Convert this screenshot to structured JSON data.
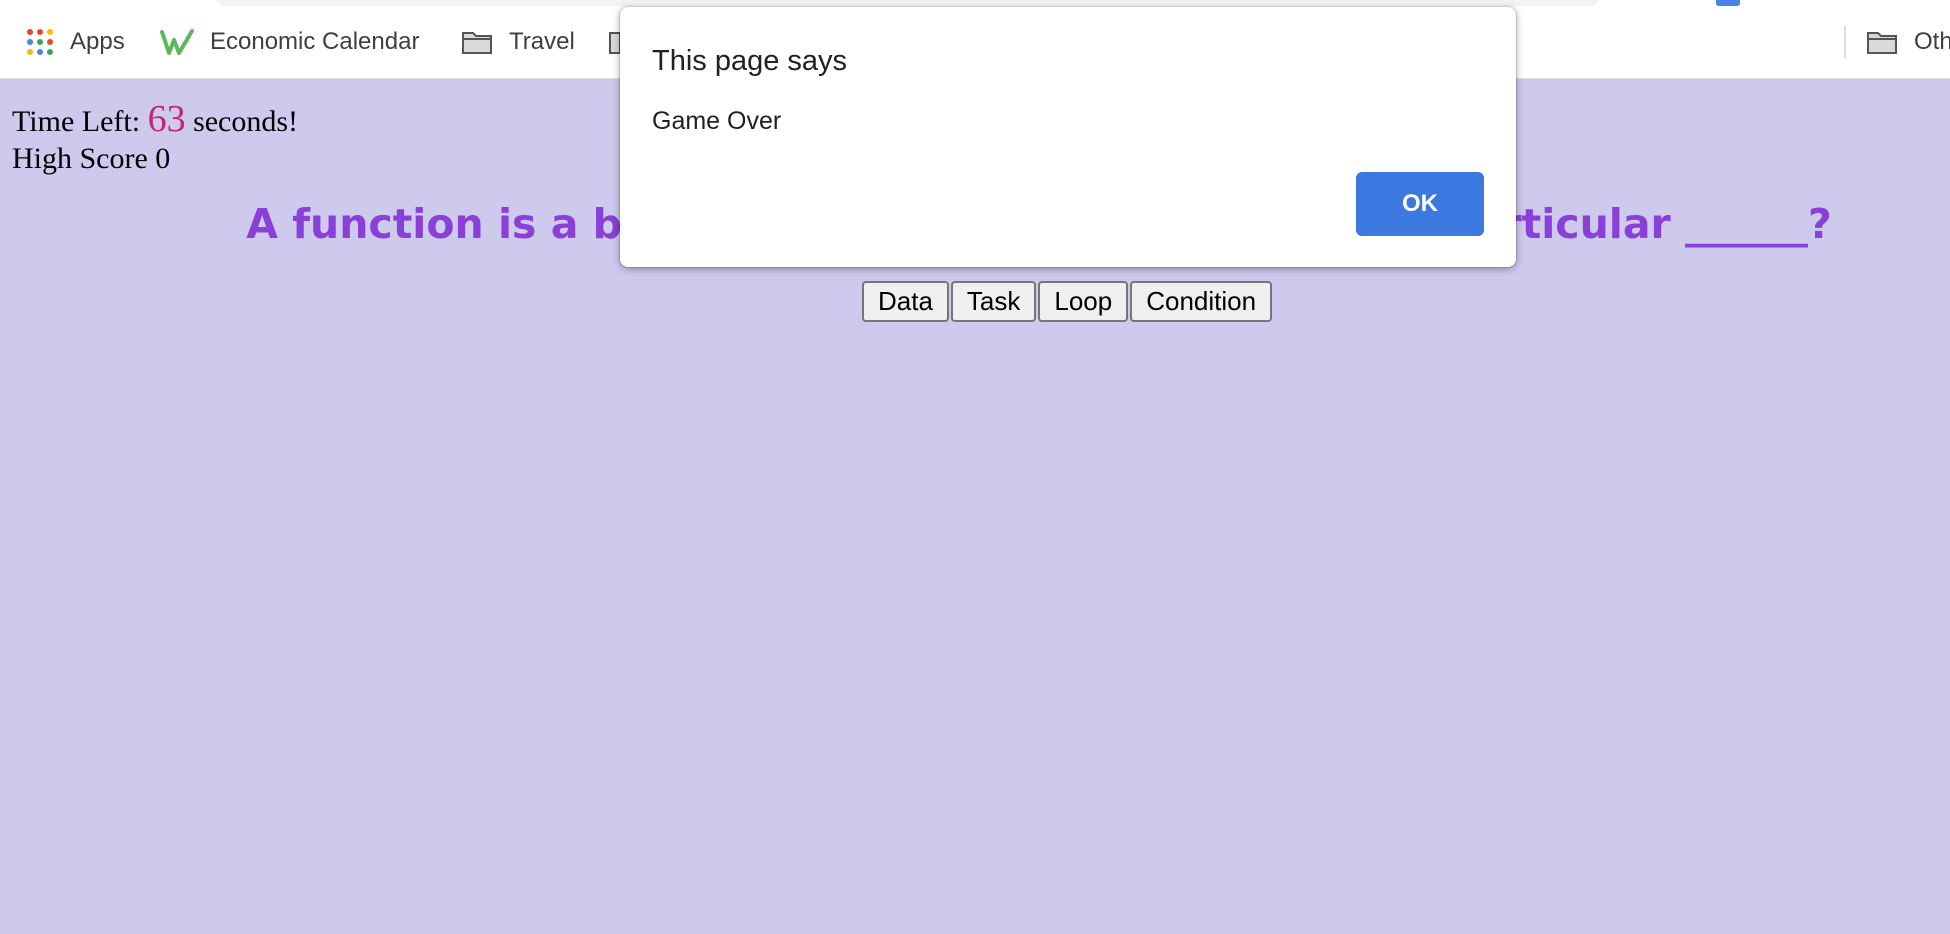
{
  "bookmarks": {
    "apps_label": "Apps",
    "economic_calendar_label": "Economic Calendar",
    "travel_label": "Travel",
    "other_label_partial": "Oth"
  },
  "game": {
    "time_left_prefix": "Time Left:",
    "time_left_value": "63",
    "time_left_suffix": "seconds!",
    "high_score_text": "High Score 0",
    "question": "A function is a block of code designed to perform a particular ______?",
    "answers": [
      "Data",
      "Task",
      "Loop",
      "Condition"
    ]
  },
  "dialog": {
    "title": "This page says",
    "message": "Game Over",
    "ok_label": "OK"
  },
  "colors": {
    "page_background": "#cdcaee",
    "question_color": "#8a3fd8",
    "timer_value_color": "#c2257a",
    "ok_button": "#3b78e0"
  },
  "icons": [
    "apps-grid-icon",
    "economic-calendar-w-icon",
    "folder-icon"
  ]
}
